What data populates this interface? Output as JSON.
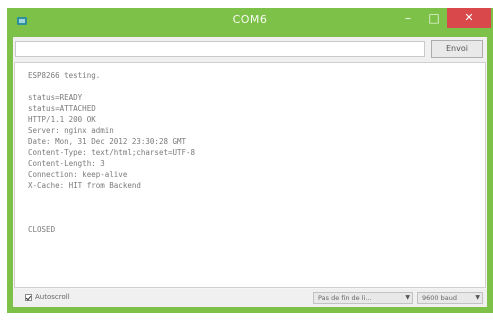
{
  "window": {
    "title": "COM6",
    "controls": {
      "minimize": "–",
      "maximize": "□",
      "close": "✕"
    },
    "accent": "#7ec148",
    "close_color": "#d9494b"
  },
  "send": {
    "input_value": "",
    "button_label": "Envoi"
  },
  "output": {
    "lines": [
      "ESP8266 testing.",
      "",
      "status=READY",
      "status=ATTACHED",
      "HTTP/1.1 200 OK",
      "Server: nginx admin",
      "Date: Mon, 31 Dec 2012 23:30:28 GMT",
      "Content-Type: text/html;charset=UTF-8",
      "Content-Length: 3",
      "Connection: keep-alive",
      "X-Cache: HIT from Backend",
      "",
      "",
      "",
      "CLOSED"
    ]
  },
  "status": {
    "autoscroll_label": "Autoscroll",
    "autoscroll_checked": true,
    "line_ending": "Pas de fin de li...",
    "baud": "9600 baud"
  }
}
